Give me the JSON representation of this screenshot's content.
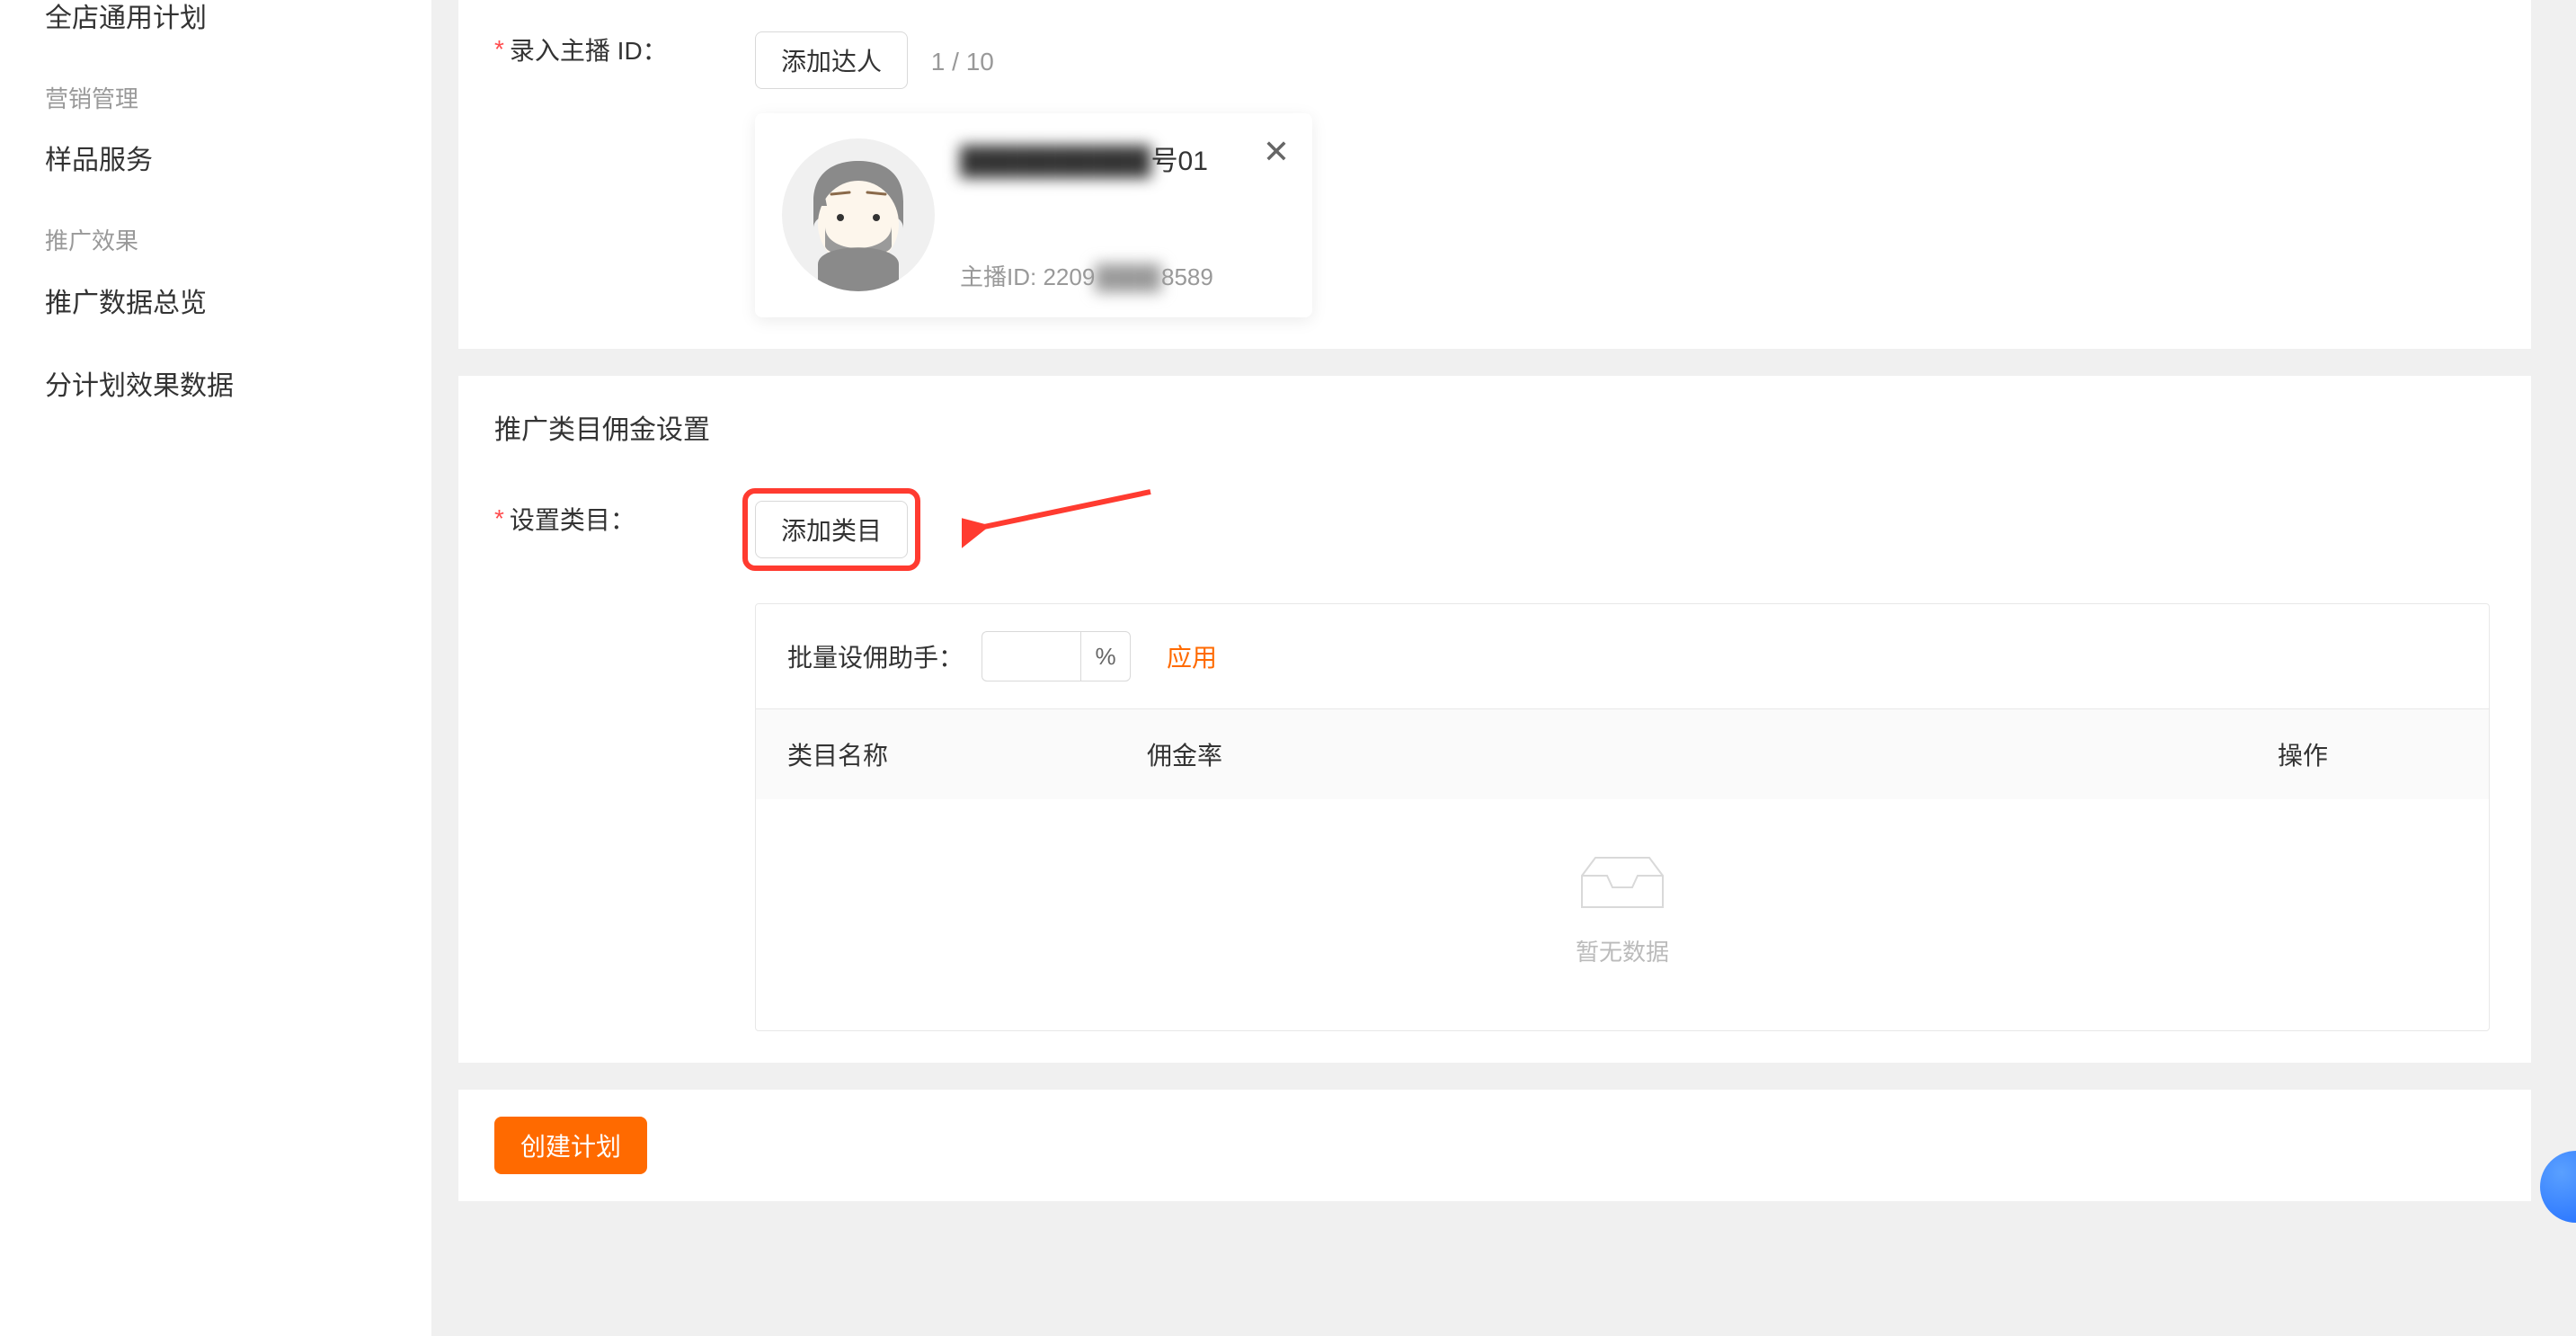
{
  "sidebar": {
    "items": [
      {
        "label": "全店通用计划",
        "type": "item"
      },
      {
        "label": "营销管理",
        "type": "section"
      },
      {
        "label": "样品服务",
        "type": "item"
      },
      {
        "label": "推广效果",
        "type": "section"
      },
      {
        "label": "推广数据总览",
        "type": "item"
      },
      {
        "label": "分计划效果数据",
        "type": "item"
      }
    ]
  },
  "form": {
    "anchor_id_label": "录入主播 ID：",
    "add_kol_btn": "添加达人",
    "counter": "1 / 10"
  },
  "kol_card": {
    "name_blur": "██████████",
    "name_suffix": "号01",
    "id_prefix": "主播ID: 2209",
    "id_blur": "████",
    "id_suffix": "8589"
  },
  "commission": {
    "section_title": "推广类目佣金设置",
    "set_category_label": "设置类目：",
    "add_category_btn": "添加类目",
    "batch_label": "批量设佣助手：",
    "percent_symbol": "%",
    "apply_btn": "应用",
    "table": {
      "col_name": "类目名称",
      "col_rate": "佣金率",
      "col_op": "操作"
    },
    "empty_text": "暂无数据"
  },
  "footer": {
    "create_btn": "创建计划"
  }
}
